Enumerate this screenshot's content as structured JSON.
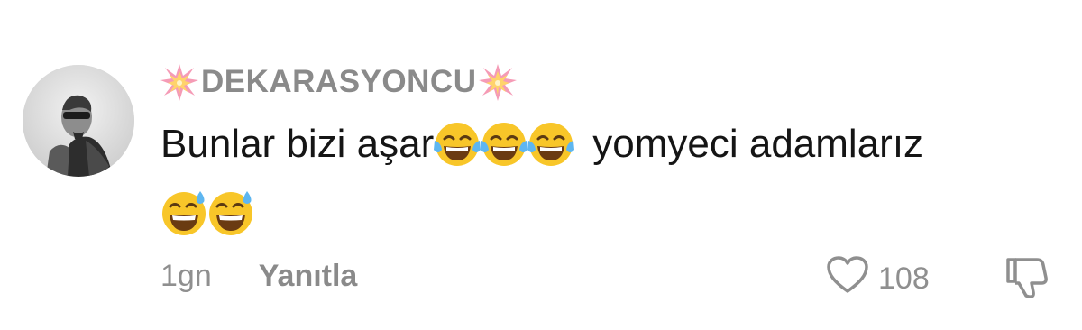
{
  "comment": {
    "username": "DEKARASYONCU",
    "username_prefix_icon": "collision-emoji-icon",
    "username_suffix_icon": "collision-emoji-icon",
    "text_before_emojis": "Bunlar bizi aşar",
    "text_after_emojis": "yomyeci adamlarız",
    "laughing_emoji_icon": "face-with-tears-of-joy-emoji",
    "sweat_emoji_icon": "grinning-face-with-sweat-emoji",
    "time": "1gn",
    "reply_label": "Yanıtla",
    "like_count": "108",
    "like_icon": "heart-outline-icon",
    "dislike_icon": "thumbs-down-outline-icon"
  },
  "colors": {
    "text": "#151515",
    "muted": "#8f8f8f",
    "background": "#ffffff",
    "emoji_yellow": "#f8c629"
  }
}
